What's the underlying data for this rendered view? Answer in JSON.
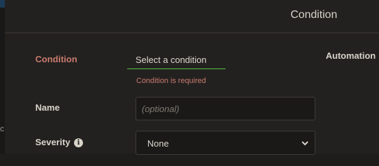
{
  "header": {
    "title": "Condition"
  },
  "edge": {
    "text": "c"
  },
  "form": {
    "condition": {
      "label": "Condition",
      "value": "Select a condition",
      "error": "Condition is required"
    },
    "name": {
      "label": "Name",
      "placeholder": "(optional)",
      "value": ""
    },
    "severity": {
      "label": "Severity",
      "info_icon": "info-icon",
      "value": "None"
    }
  },
  "side": {
    "automation_label": "Automation"
  },
  "colors": {
    "error": "#c97b6c",
    "focus_underline": "#57c443",
    "panel_bg": "#232120"
  }
}
